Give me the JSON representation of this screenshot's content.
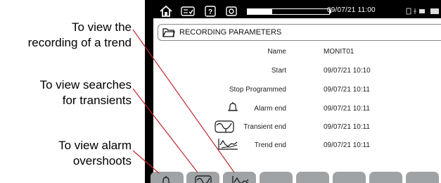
{
  "callouts": {
    "trend": "To view the\nrecording of a trend",
    "transients": "To view searches\nfor transients",
    "alarms": "To view alarm\novershoots"
  },
  "status_bar": {
    "datetime": "09/07/21 11:00",
    "battery_level_percent": 30,
    "icons": [
      "home-icon",
      "checklist-icon",
      "help-icon",
      "camera-icon",
      "connection-icon"
    ]
  },
  "header": {
    "title": "RECORDING PARAMETERS",
    "icon": "folder-icon"
  },
  "parameters": [
    {
      "label": "Name",
      "value": "MONIT01",
      "icon": null
    },
    {
      "label": "Start",
      "value": "09/07/21 10:10",
      "icon": null
    },
    {
      "label": "Stop Programmed",
      "value": "09/07/21 10:11",
      "icon": null
    },
    {
      "label": "Alarm end",
      "value": "09/07/21 10:11",
      "icon": "bell-icon"
    },
    {
      "label": "Transient end",
      "value": "09/07/21 10:11",
      "icon": "transient-icon"
    },
    {
      "label": "Trend end",
      "value": "09/07/21 10:11",
      "icon": "trend-icon"
    }
  ],
  "function_keys": [
    "bell-icon",
    "transient-icon",
    "trend-icon",
    "",
    "",
    "",
    "",
    ""
  ],
  "colors": {
    "leader_line": "#c0272d",
    "key_gray": "#9fa3a6",
    "screen_frame": "#000000"
  }
}
